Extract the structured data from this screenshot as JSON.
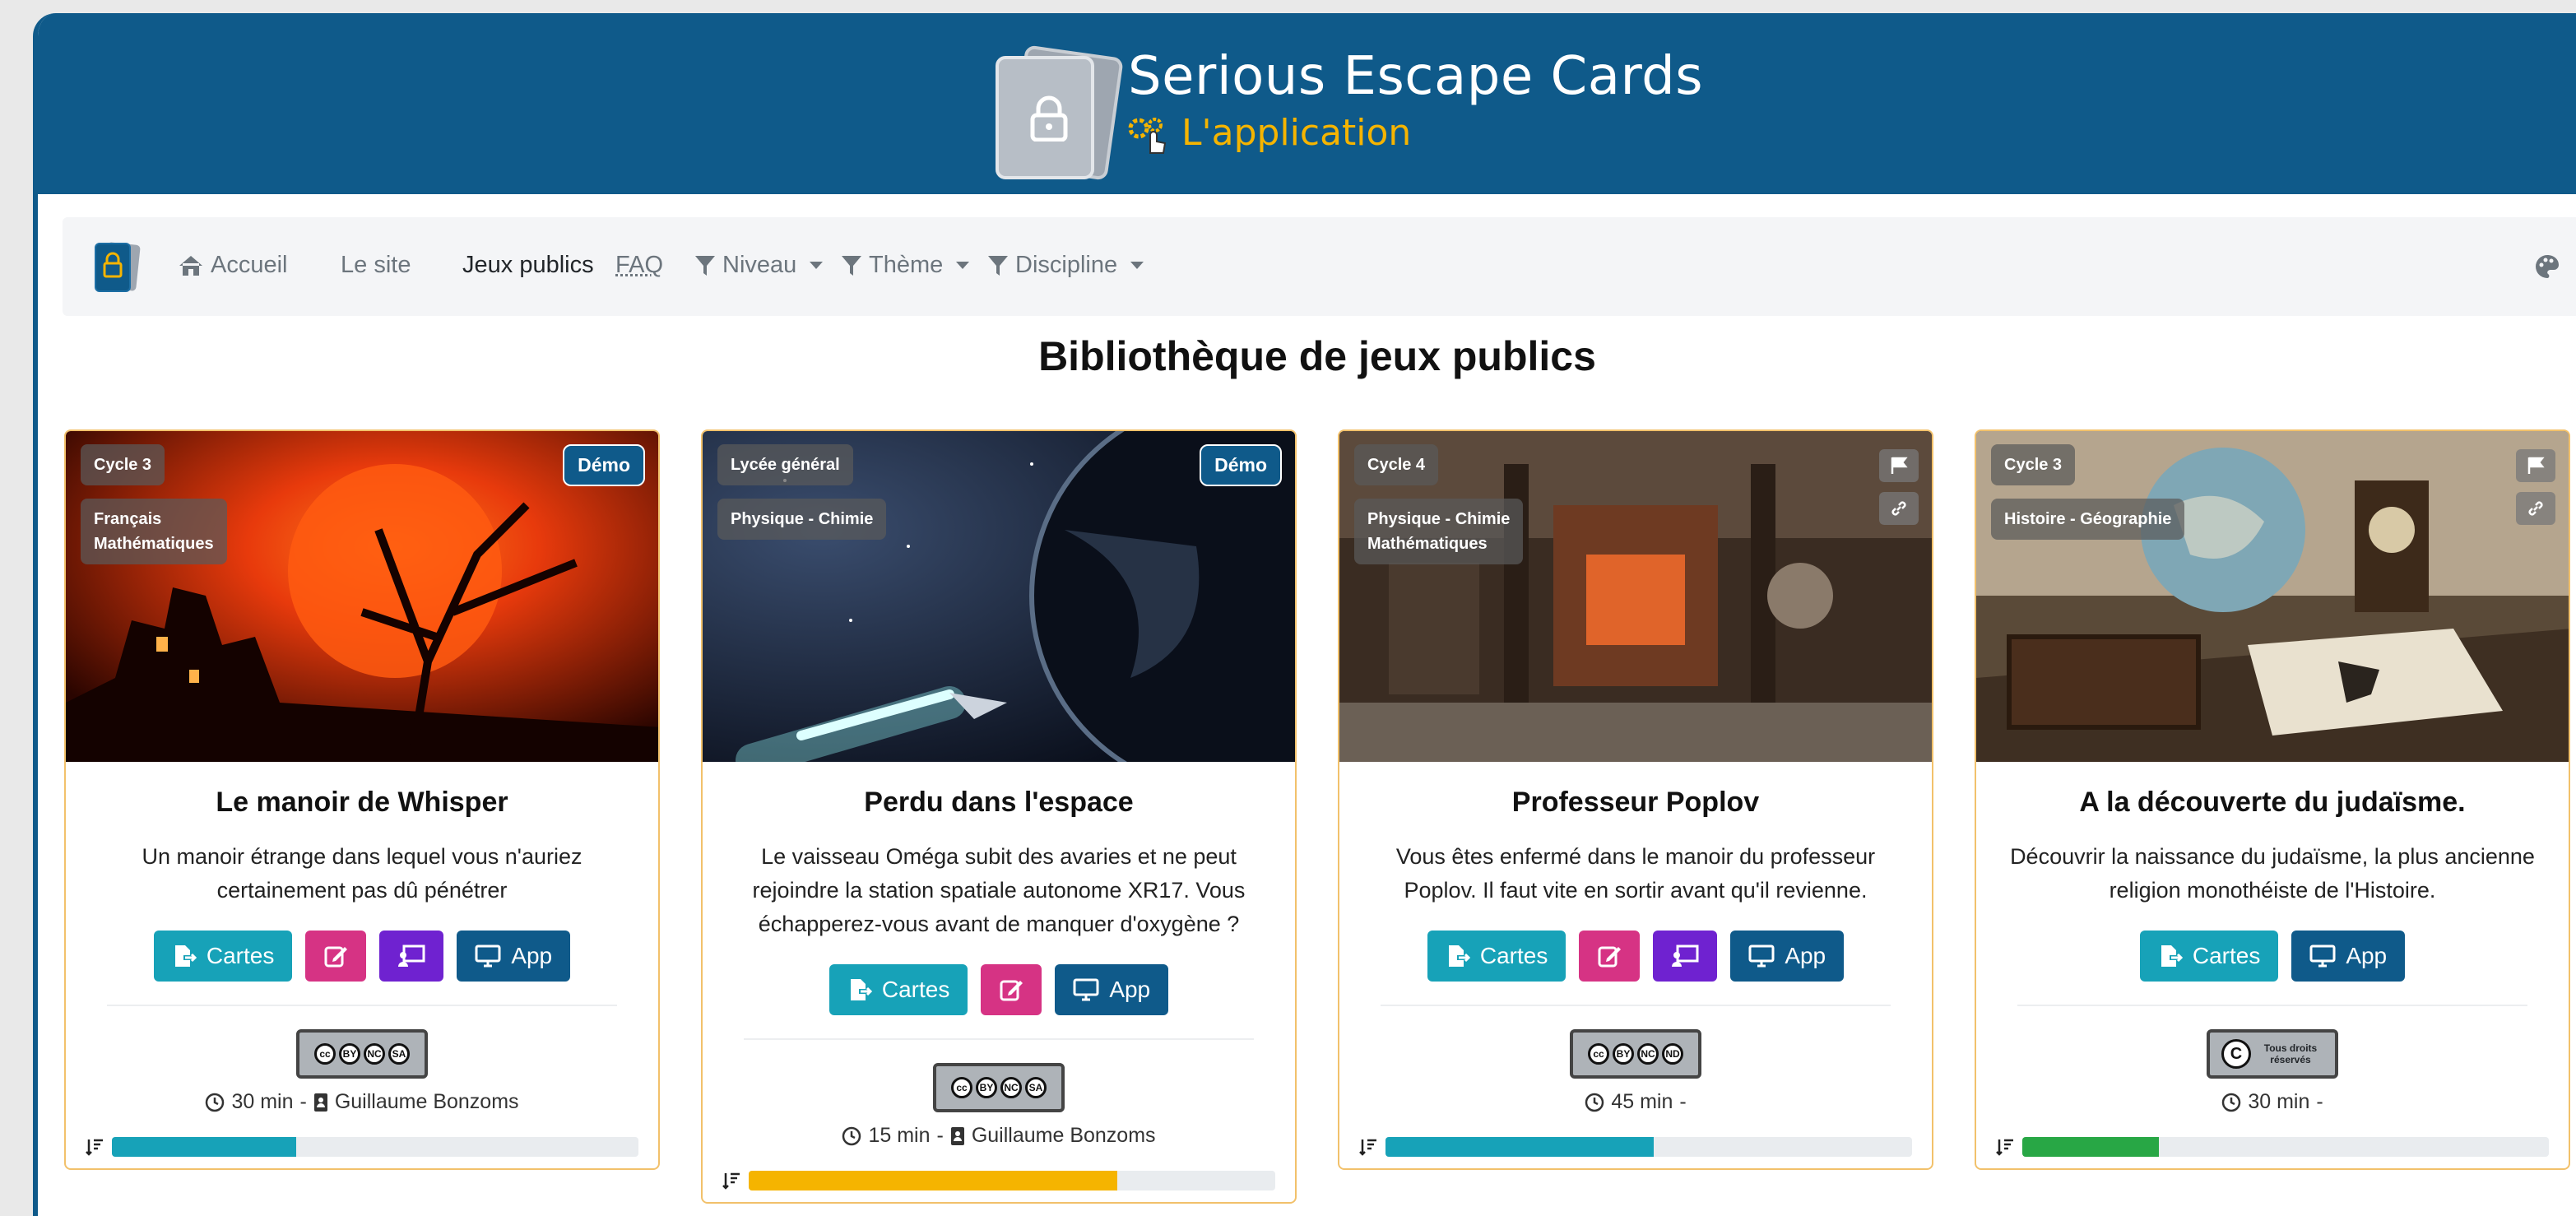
{
  "header": {
    "brand_title": "Serious Escape Cards",
    "brand_subtitle": "L'application",
    "accent_color": "#f5b400",
    "banner_color": "#0f5a8a"
  },
  "nav": {
    "items": [
      {
        "label": "Accueil",
        "icon": "home-icon"
      },
      {
        "label": "Le site"
      },
      {
        "label": "Jeux publics",
        "active": true
      },
      {
        "label": "FAQ"
      },
      {
        "label": "Niveau",
        "icon": "filter-icon",
        "dropdown": true
      },
      {
        "label": "Thème",
        "icon": "filter-icon",
        "dropdown": true
      },
      {
        "label": "Discipline",
        "icon": "filter-icon",
        "dropdown": true
      }
    ],
    "right_icon": "palette-icon"
  },
  "page_title": "Bibliothèque de jeux publics",
  "buttons": {
    "cartes": "Cartes",
    "app": "App",
    "demo": "Démo"
  },
  "cards": [
    {
      "tags": [
        "Cycle 3",
        "Français\nMathématiques"
      ],
      "demo": true,
      "title": "Le manoir de Whisper",
      "description": "Un manoir étrange dans lequel vous n'auriez certainement pas dû pénétrer",
      "license": [
        "BY",
        "NC",
        "SA"
      ],
      "duration": "30 min",
      "author": "Guillaume Bonzoms",
      "progress": 0.35,
      "progress_color": "#17a2b8"
    },
    {
      "tags": [
        "Lycée général",
        "Physique - Chimie"
      ],
      "demo": true,
      "title": "Perdu dans l'espace",
      "description": "Le vaisseau Oméga subit des avaries et ne peut rejoindre la station spatiale autonome XR17. Vous échapperez-vous avant de manquer d'oxygène ?",
      "license": [
        "BY",
        "NC",
        "SA"
      ],
      "duration": "15 min",
      "author": "Guillaume Bonzoms",
      "progress": 0.7,
      "progress_color": "#f5b400"
    },
    {
      "tags": [
        "Cycle 4",
        "Physique - Chimie\nMathématiques"
      ],
      "demo": false,
      "title": "Professeur Poplov",
      "description": "Vous êtes enfermé dans le manoir du professeur Poplov. Il faut vite en sortir avant qu'il revienne.",
      "license": [
        "BY",
        "NC",
        "ND"
      ],
      "duration": "45 min",
      "author": "",
      "progress": 0.51,
      "progress_color": "#17a2b8"
    },
    {
      "tags": [
        "Cycle 3",
        "Histoire - Géographie"
      ],
      "demo": false,
      "title": "A la découverte du judaïsme.",
      "description": "Découvrir la naissance du judaïsme, la plus ancienne religion monothéiste de l'Histoire.",
      "license_text": "Tous droits réservés",
      "duration": "30 min",
      "author": "",
      "progress": 0.26,
      "progress_color": "#28a745"
    }
  ]
}
